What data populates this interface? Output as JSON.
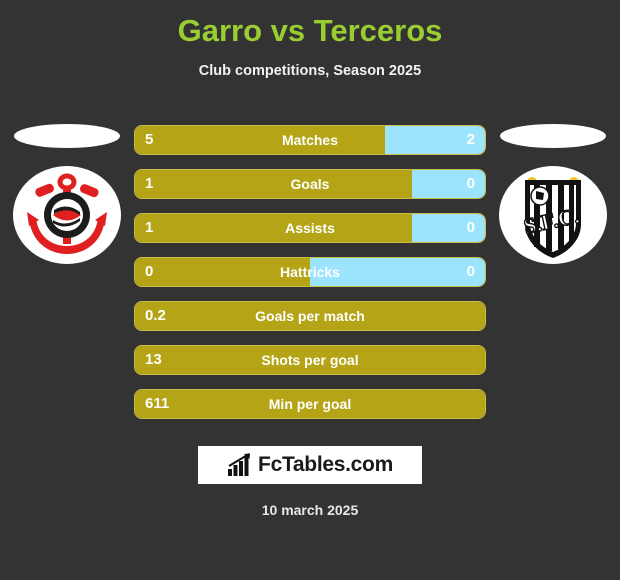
{
  "header": {
    "title": "Garro vs Terceros",
    "subtitle": "Club competitions, Season 2025",
    "title_color": "#9ACD32"
  },
  "teams": {
    "left": {
      "name": "Corinthians",
      "logo": "corinthians-crest-icon"
    },
    "right": {
      "name": "Santos FC",
      "logo": "santos-crest-icon"
    }
  },
  "colors": {
    "background": "#333333",
    "player_left_bar": "#B5A516",
    "player_right_bar": "#9BE4FB",
    "bar_border": "#cbbd4a",
    "text": "#ffffff"
  },
  "chart_data": {
    "type": "bar",
    "title": "Garro vs Terceros",
    "subtitle": "Club competitions, Season 2025",
    "orientation": "horizontal-diverging",
    "series": [
      {
        "name": "Garro",
        "side": "left",
        "color": "#B5A516"
      },
      {
        "name": "Terceros",
        "side": "right",
        "color": "#9BE4FB"
      }
    ],
    "categories": [
      "Matches",
      "Goals",
      "Assists",
      "Hattricks",
      "Goals per match",
      "Shots per goal",
      "Min per goal"
    ],
    "rows": [
      {
        "label": "Matches",
        "left_value": "5",
        "right_value": "2",
        "left_pct": 71.5,
        "has_right": true
      },
      {
        "label": "Goals",
        "left_value": "1",
        "right_value": "0",
        "left_pct": 79,
        "has_right": true
      },
      {
        "label": "Assists",
        "left_value": "1",
        "right_value": "0",
        "left_pct": 79,
        "has_right": true
      },
      {
        "label": "Hattricks",
        "left_value": "0",
        "right_value": "0",
        "left_pct": 50,
        "has_right": true
      },
      {
        "label": "Goals per match",
        "left_value": "0.2",
        "right_value": "",
        "left_pct": 100,
        "has_right": false
      },
      {
        "label": "Shots per goal",
        "left_value": "13",
        "right_value": "",
        "left_pct": 100,
        "has_right": false
      },
      {
        "label": "Min per goal",
        "left_value": "611",
        "right_value": "",
        "left_pct": 100,
        "has_right": false
      }
    ]
  },
  "footer": {
    "brand_text": "FcTables.com",
    "brand_icon": "bar-chart-growth-icon",
    "date": "10 march 2025"
  }
}
